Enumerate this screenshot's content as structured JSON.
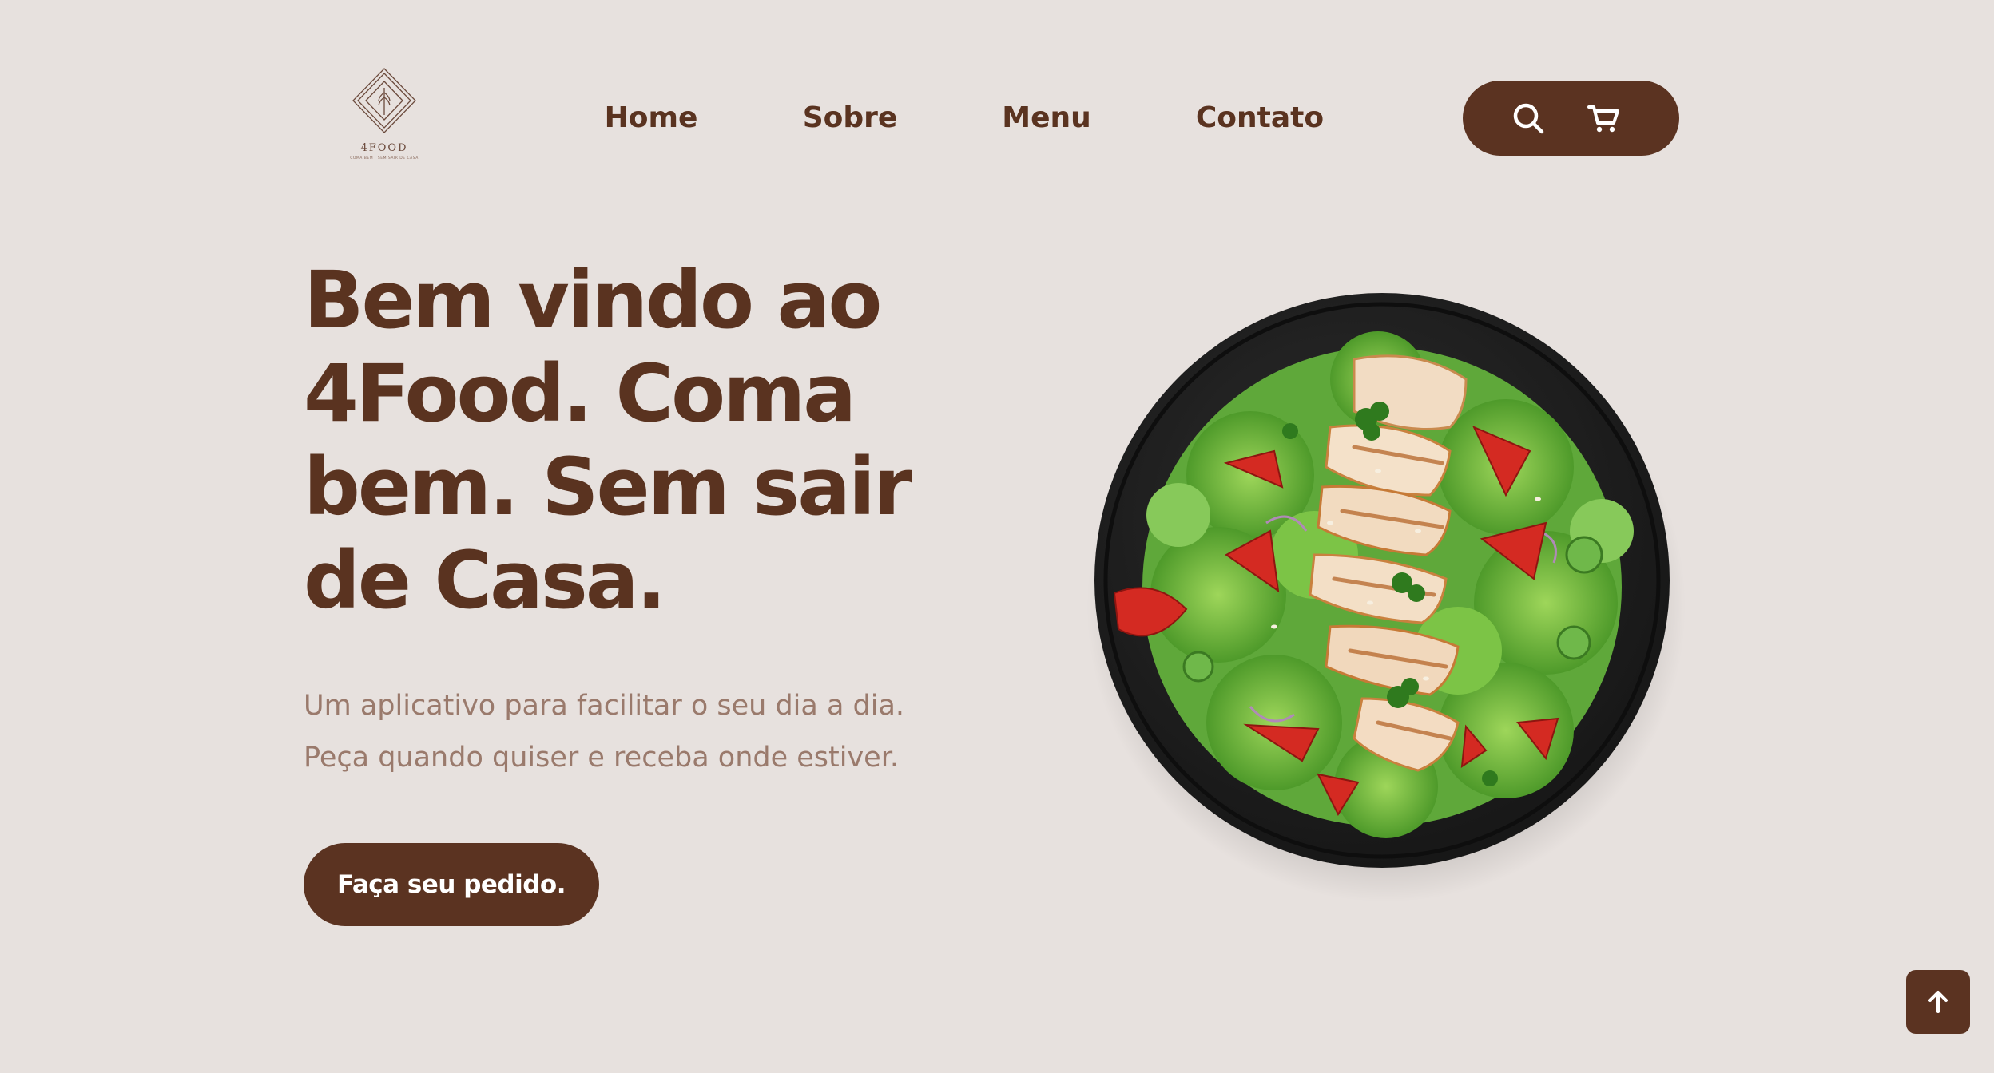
{
  "brand": {
    "name": "4FOOD",
    "tagline": "COMA BEM · SEM SAIR DE CASA"
  },
  "nav": {
    "items": [
      {
        "label": "Home"
      },
      {
        "label": "Sobre"
      },
      {
        "label": "Menu"
      },
      {
        "label": "Contato"
      }
    ]
  },
  "header_actions": {
    "search_icon": "search-icon",
    "cart_icon": "cart-icon"
  },
  "hero": {
    "title": "Bem vindo ao 4Food. Coma bem. Sem sair de Casa.",
    "subtitle_line1": "Um aplicativo para facilitar o seu dia a dia.",
    "subtitle_line2": "Peça quando quiser e receba onde estiver.",
    "cta_label": "Faça seu pedido.",
    "image": "salad-plate-image"
  },
  "back_to_top": {
    "icon": "arrow-up-icon"
  },
  "colors": {
    "background": "#e7e1de",
    "primary": "#5b3321",
    "subtitle": "#9a7a6c"
  }
}
